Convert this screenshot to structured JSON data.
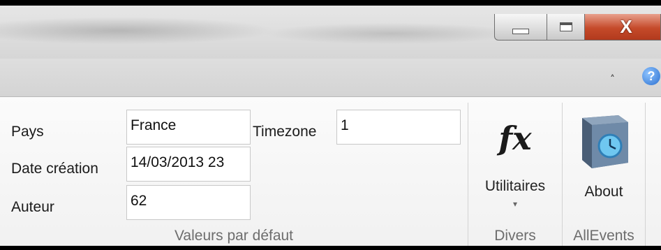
{
  "window_controls": {
    "minimize_icon": "minimize-icon",
    "maximize_icon": "maximize-icon",
    "close_label": "X"
  },
  "tabstrip": {
    "collapse_icon": "chevron-up-icon",
    "help_label": "?"
  },
  "groups": {
    "defaults": {
      "label": "Valeurs par défaut",
      "fields": {
        "pays": {
          "label": "Pays",
          "value": "France"
        },
        "timezone": {
          "label": "Timezone",
          "value": "1"
        },
        "date_creation": {
          "label": "Date création",
          "value": "14/03/2013 23"
        },
        "auteur": {
          "label": "Auteur",
          "value": "62"
        }
      }
    },
    "divers": {
      "label": "Divers",
      "utilitaires_button": {
        "icon": "function-fx-icon",
        "glyph": "fx",
        "label": "Utilitaires",
        "dropdown": "▾"
      }
    },
    "allevents": {
      "label": "AllEvents",
      "about_button": {
        "icon": "clock-box-icon",
        "label": "About"
      }
    }
  },
  "colors": {
    "close_button": "#c54a2a",
    "help_icon": "#2a6fcf",
    "group_label": "#6d6d6d"
  }
}
